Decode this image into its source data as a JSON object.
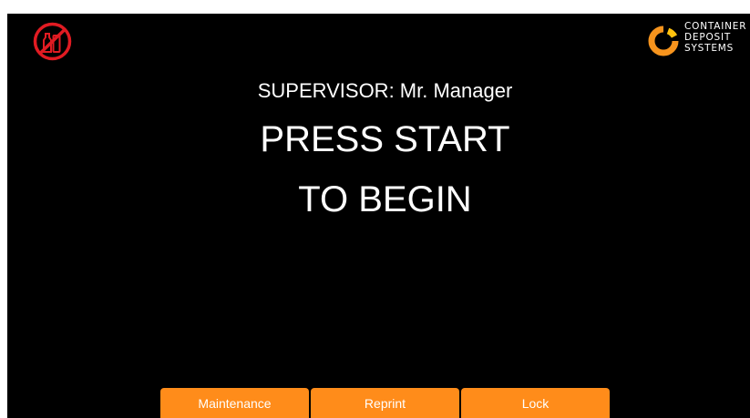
{
  "header": {
    "left_icon": "no-bottles-icon",
    "brand": {
      "mark_icon": "container-deposit-logo-icon",
      "line1": "CONTAINER",
      "line2": "DEPOSIT",
      "line3": "SYSTEMS"
    }
  },
  "main": {
    "supervisor_text": "SUPERVISOR: Mr. Manager",
    "headline_line1": "PRESS START",
    "headline_line2": "TO BEGIN"
  },
  "actions": {
    "maintenance_label": "Maintenance",
    "reprint_label": "Reprint",
    "lock_label": "Lock"
  },
  "colors": {
    "background": "#000000",
    "button": "#ff8c1a",
    "prohibition_red": "#e11b22",
    "logo_orange": "#f7941d",
    "logo_yellow": "#ffc20e",
    "text": "#ffffff"
  }
}
